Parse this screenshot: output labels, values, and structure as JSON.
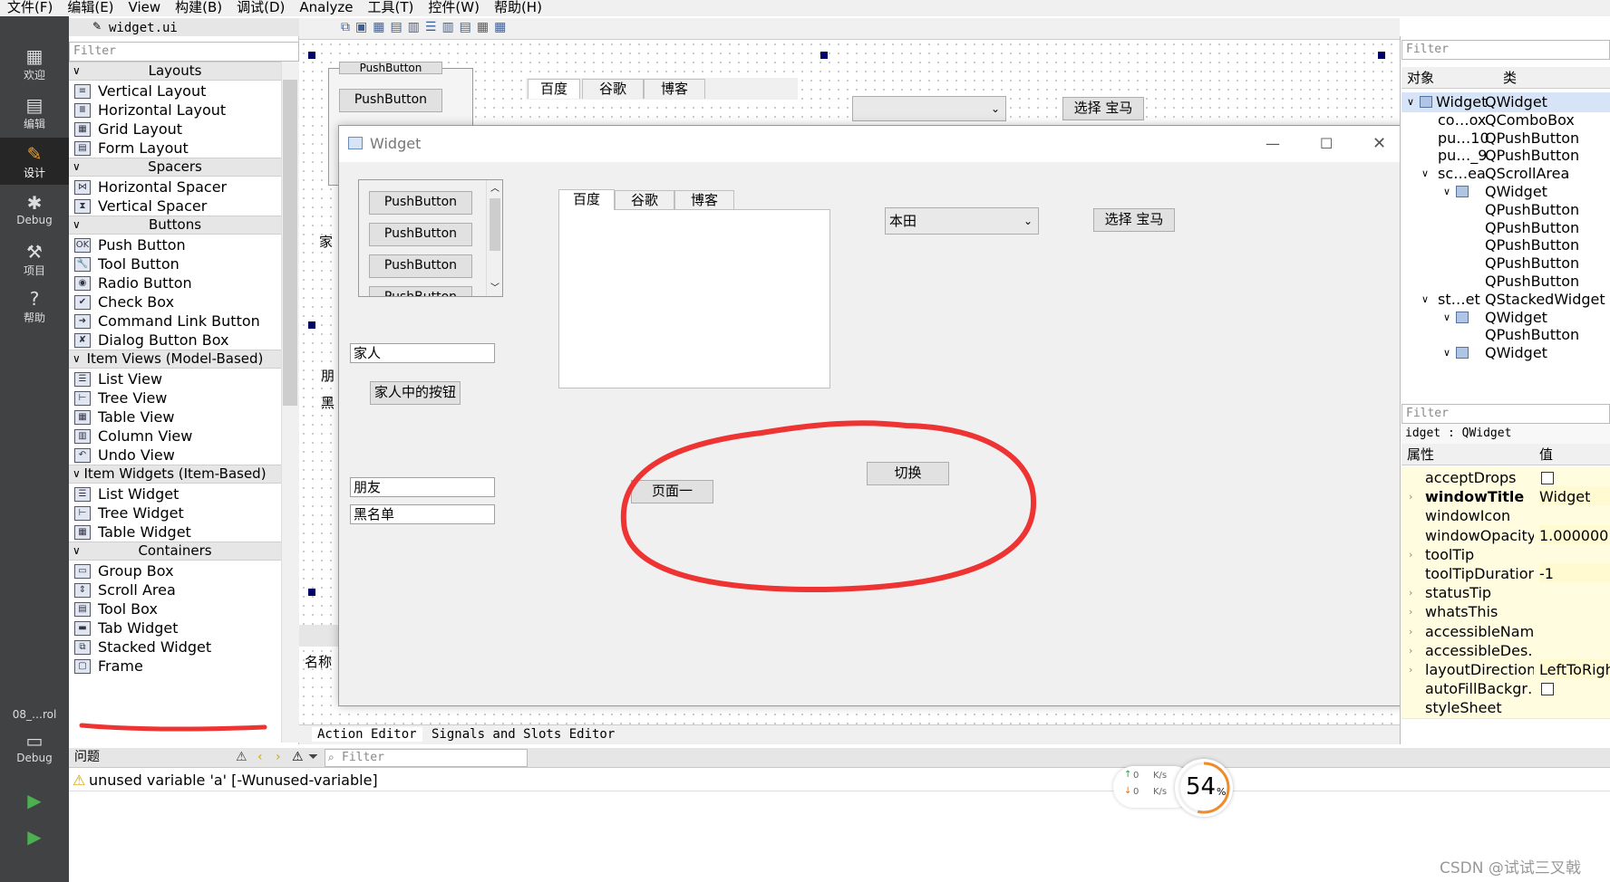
{
  "menubar": [
    "文件(F)",
    "编辑(E)",
    "View",
    "构建(B)",
    "调试(D)",
    "Analyze",
    "工具(T)",
    "控件(W)",
    "帮助(H)"
  ],
  "modes": [
    {
      "icon": "grid-icon",
      "label": "欢迎"
    },
    {
      "icon": "edit-icon",
      "label": "编辑"
    },
    {
      "icon": "pencil-icon",
      "label": "设计"
    },
    {
      "icon": "bug-icon",
      "label": "Debug"
    },
    {
      "icon": "wrench-icon",
      "label": "项目"
    },
    {
      "icon": "help-icon",
      "label": "帮助"
    }
  ],
  "build_target": {
    "project": "08_…rol",
    "config": "Debug"
  },
  "editor": {
    "file_tab": "widget.ui"
  },
  "widgetbox": {
    "filter_placeholder": "Filter",
    "categories": [
      {
        "title": "Layouts",
        "items": [
          "Vertical Layout",
          "Horizontal Layout",
          "Grid Layout",
          "Form Layout"
        ]
      },
      {
        "title": "Spacers",
        "items": [
          "Horizontal Spacer",
          "Vertical Spacer"
        ]
      },
      {
        "title": "Buttons",
        "items": [
          "Push Button",
          "Tool Button",
          "Radio Button",
          "Check Box",
          "Command Link Button",
          "Dialog Button Box"
        ]
      },
      {
        "title": "Item Views (Model-Based)",
        "items": [
          "List View",
          "Tree View",
          "Table View",
          "Column View",
          "Undo View"
        ]
      },
      {
        "title": "Item Widgets (Item-Based)",
        "items": [
          "List Widget",
          "Tree Widget",
          "Table Widget"
        ]
      },
      {
        "title": "Containers",
        "items": [
          "Group Box",
          "Scroll Area",
          "Tool Box",
          "Tab Widget",
          "Stacked Widget",
          "Frame"
        ]
      }
    ]
  },
  "designer_bg": {
    "pushbutton_top": "PushButton",
    "pushbutton": "PushButton",
    "tabs": [
      "百度",
      "谷歌",
      "博客"
    ],
    "select_button": "选择 宝马",
    "partial_labels": [
      "家",
      "朋",
      "黑"
    ]
  },
  "preview": {
    "title": "Widget",
    "scroll_buttons": [
      "PushButton",
      "PushButton",
      "PushButton",
      "PushButton"
    ],
    "toolbox_pages": [
      "家人",
      "朋友",
      "黑名单"
    ],
    "family_button": "家人中的按钮",
    "tabs": [
      "百度",
      "谷歌",
      "博客"
    ],
    "combo_value": "本田",
    "select_button": "选择 宝马",
    "switch_button": "切换",
    "page_one": "页面一"
  },
  "action_editor": {
    "name_col": "名称",
    "tabs": [
      "Action Editor",
      "Signals and Slots Editor"
    ]
  },
  "object_inspector": {
    "filter_placeholder": "Filter",
    "col_object": "对象",
    "col_class": "类",
    "rows": [
      {
        "obj": "Widget",
        "cls": "QWidget"
      },
      {
        "obj": "co…ox",
        "cls": "QComboBox"
      },
      {
        "obj": "pu…10",
        "cls": "QPushButton"
      },
      {
        "obj": "pu…_9",
        "cls": "QPushButton"
      },
      {
        "obj": "sc…ea",
        "cls": "QScrollArea"
      },
      {
        "obj": "",
        "cls": "QWidget"
      },
      {
        "obj": "",
        "cls": "QPushButton"
      },
      {
        "obj": "",
        "cls": "QPushButton"
      },
      {
        "obj": "",
        "cls": "QPushButton"
      },
      {
        "obj": "",
        "cls": "QPushButton"
      },
      {
        "obj": "",
        "cls": "QPushButton"
      },
      {
        "obj": "st…et",
        "cls": "QStackedWidget"
      },
      {
        "obj": "",
        "cls": "QWidget"
      },
      {
        "obj": "",
        "cls": "QPushButton"
      },
      {
        "obj": "",
        "cls": "QWidget"
      }
    ]
  },
  "property_editor": {
    "filter_placeholder": "Filter",
    "object_label": "idget : QWidget",
    "col_prop": "属性",
    "col_value": "值",
    "rows": [
      {
        "name": "acceptDrops",
        "value": ""
      },
      {
        "name": "windowTitle",
        "value": "Widget"
      },
      {
        "name": "windowIcon",
        "value": ""
      },
      {
        "name": "windowOpacity",
        "value": "1.000000"
      },
      {
        "name": "toolTip",
        "value": ""
      },
      {
        "name": "toolTipDuration",
        "value": "-1"
      },
      {
        "name": "statusTip",
        "value": ""
      },
      {
        "name": "whatsThis",
        "value": ""
      },
      {
        "name": "accessibleName",
        "value": ""
      },
      {
        "name": "accessibleDes…",
        "value": ""
      },
      {
        "name": "layoutDirection",
        "value": "LeftToRigh"
      },
      {
        "name": "autoFillBackgr…",
        "value": ""
      },
      {
        "name": "styleSheet",
        "value": ""
      }
    ]
  },
  "issues": {
    "title": "问题",
    "filter_placeholder": "Filter",
    "message": "unused variable 'a' [-Wunused-variable]"
  },
  "speed": {
    "up": "0",
    "down": "0",
    "unit": "K/s",
    "percent": "54",
    "percent_sign": "%"
  },
  "watermark": "CSDN @试试三叉戟",
  "annotation_color": "#ee3333"
}
